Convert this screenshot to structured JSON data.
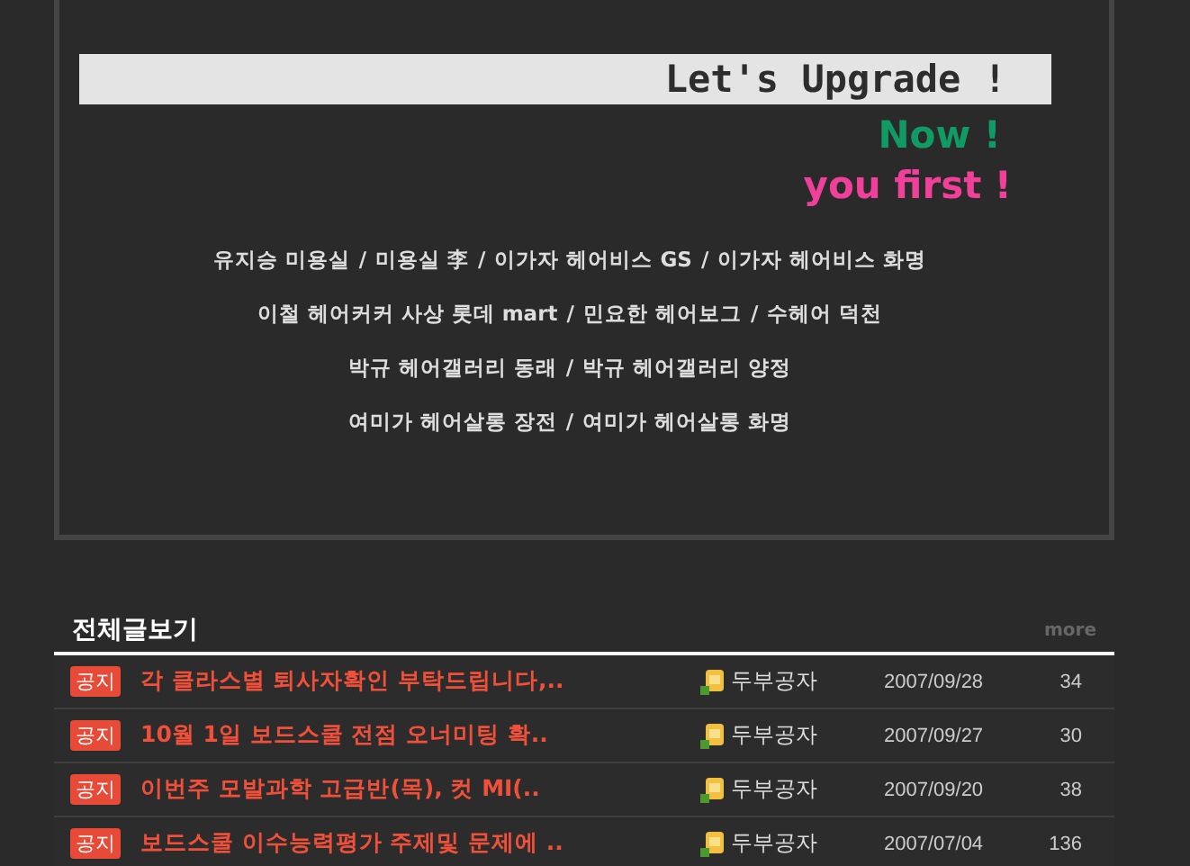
{
  "banner": {
    "headline": "Let's  Upgrade !",
    "line_2": "Now !",
    "line_3": "you first !"
  },
  "shop_lines": [
    [
      "유지승 미용실",
      "미용실 李",
      "이가자 헤어비스 GS",
      "이가자 헤어비스 화명"
    ],
    [
      "이철 헤어커커 사상 롯데 mart",
      "민요한 헤어보그",
      "수헤어  덕천"
    ],
    [
      "박규 헤어갤러리 동래",
      "박규 헤어갤러리 양정"
    ],
    [
      "여미가 헤어살롱 장전",
      "여미가 헤어살롱 화명"
    ]
  ],
  "separator": "/",
  "board": {
    "title": "전체글보기",
    "more": "more",
    "rows": [
      {
        "badge": "공지",
        "title": "각 클라스별 퇴사자확인 부탁드립니다,..",
        "author": "두부공자",
        "date": "2007/09/28",
        "views": "34"
      },
      {
        "badge": "공지",
        "title": "10월 1일 보드스쿨 전점 오너미팅 확..",
        "author": "두부공자",
        "date": "2007/09/27",
        "views": "30"
      },
      {
        "badge": "공지",
        "title": "이번주 모발과학 고급반(목), 컷 MI(..",
        "author": "두부공자",
        "date": "2007/09/20",
        "views": "38"
      },
      {
        "badge": "공지",
        "title": "보드스쿨 이수능력평가 주제및 문제에 ..",
        "author": "두부공자",
        "date": "2007/07/04",
        "views": "136"
      }
    ]
  }
}
